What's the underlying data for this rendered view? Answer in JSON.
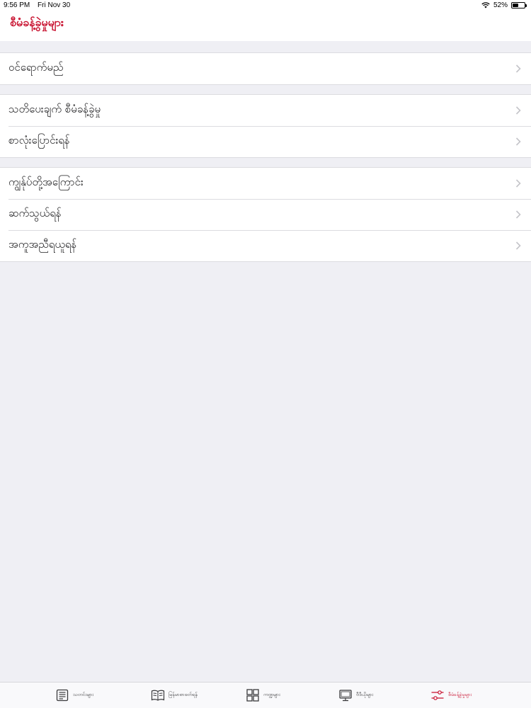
{
  "status_bar": {
    "time": "9:56 PM",
    "date": "Fri Nov 30",
    "battery": "52%",
    "battery_level": 0.52
  },
  "nav": {
    "title": "စီမံခန့်ခွဲမှုများ"
  },
  "groups": [
    {
      "rows": [
        {
          "label": "ဝင်ရောက်မည်"
        }
      ]
    },
    {
      "rows": [
        {
          "label": "သတိပေးချက် စီမံခန့်ခွဲမှု"
        },
        {
          "label": "စာလုံးပြောင်းရန်"
        }
      ]
    },
    {
      "rows": [
        {
          "label": "ကျွန်ုပ်တို့အကြောင်း"
        },
        {
          "label": "ဆက်သွယ်ရန်"
        },
        {
          "label": "အကူအညီရယူရန်"
        }
      ]
    }
  ],
  "tabs": [
    {
      "label": "သတင်းများ",
      "icon": "newspaper-icon"
    },
    {
      "label": "မြန်မာစာဖတ်ရန်",
      "icon": "book-icon"
    },
    {
      "label": "ကဏ္ဍများ",
      "icon": "grid-icon"
    },
    {
      "label": "ဗီဒီယိုများ",
      "icon": "monitor-icon"
    },
    {
      "label": "စီမံခန့်ခွဲမှုများ",
      "icon": "sliders-icon"
    }
  ],
  "colors": {
    "accent": "#c8102e",
    "background": "#efeff4",
    "cell": "#ffffff"
  }
}
